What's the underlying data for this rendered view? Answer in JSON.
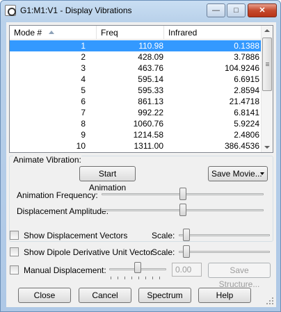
{
  "window": {
    "title": "G1:M1:V1 - Display Vibrations"
  },
  "title_buttons": {
    "minimize": "—",
    "maximize": "□",
    "close": "✕"
  },
  "table": {
    "columns": [
      "Mode #",
      "Freq",
      "Infrared"
    ],
    "rows": [
      [
        "1",
        "110.98",
        "0.1388"
      ],
      [
        "2",
        "428.09",
        "3.7886"
      ],
      [
        "3",
        "463.76",
        "104.9246"
      ],
      [
        "4",
        "595.14",
        "6.6915"
      ],
      [
        "5",
        "595.33",
        "2.8594"
      ],
      [
        "6",
        "861.13",
        "21.4718"
      ],
      [
        "7",
        "992.22",
        "6.8141"
      ],
      [
        "8",
        "1060.76",
        "5.9224"
      ],
      [
        "9",
        "1214.58",
        "2.4806"
      ],
      [
        "10",
        "1311.00",
        "386.4536"
      ]
    ],
    "selected_row": 1
  },
  "animate": {
    "group_label": "Animate Vibration:",
    "start_button": "Start Animation",
    "save_movie_button": "Save Movie...",
    "frequency_label": "Animation Frequency:",
    "frequency_level": 0.5,
    "amplitude_label": "Displacement Amplitude:",
    "amplitude_level": 0.5
  },
  "options": {
    "show_displacement_vectors": "Show Displacement Vectors",
    "show_dipole_vector": "Show Dipole Derivative Unit Vector",
    "manual_displacement": "Manual Displacement:",
    "scale_label": "Scale:",
    "manual_value": "0.00",
    "save_structure_button": "Save Structure..."
  },
  "footer": {
    "close_button": "Close",
    "cancel_button": "Cancel",
    "spectrum_button": "Spectrum",
    "help_button": "Help"
  }
}
